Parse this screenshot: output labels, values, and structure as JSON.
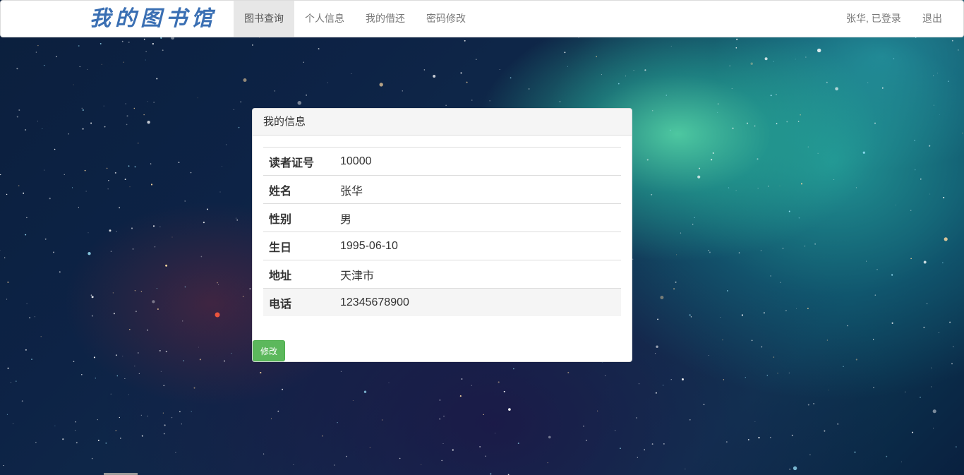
{
  "app": {
    "brand": "我的图书馆"
  },
  "nav": {
    "items": [
      {
        "label": "图书查询",
        "active": true
      },
      {
        "label": "个人信息",
        "active": false
      },
      {
        "label": "我的借还",
        "active": false
      },
      {
        "label": "密码修改",
        "active": false
      }
    ],
    "user_status": "张华, 已登录",
    "logout": "退出"
  },
  "panel": {
    "title": "我的信息",
    "rows": [
      {
        "key": "读者证号",
        "value": "10000"
      },
      {
        "key": "姓名",
        "value": "张华"
      },
      {
        "key": "性别",
        "value": "男"
      },
      {
        "key": "生日",
        "value": "1995-06-10"
      },
      {
        "key": "地址",
        "value": "天津市"
      },
      {
        "key": "电话",
        "value": "12345678900"
      }
    ],
    "edit_button": "修改"
  },
  "colors": {
    "brand": "#3a6fb3",
    "button": "#5cb85c",
    "nav_active_bg": "#e7e7e7"
  }
}
